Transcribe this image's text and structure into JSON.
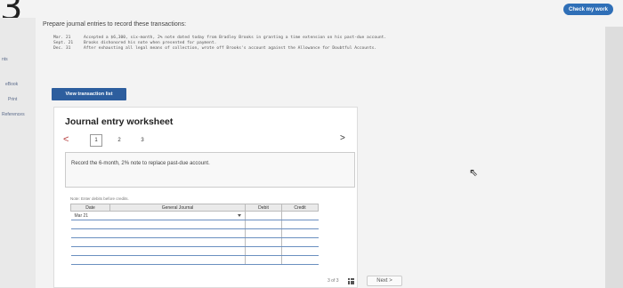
{
  "header": {
    "question_number": "3",
    "check_button": "Check my work"
  },
  "left_rail": [
    "nts",
    "eBook",
    "Print",
    "References"
  ],
  "instructions": "Prepare journal entries to record these transactions:",
  "transactions": [
    {
      "date": "Mar. 21",
      "text": "Accepted a $6,300, six-month, 2% note dated today from Bradley Brooks in granting a time extension on his past-due account."
    },
    {
      "date": "Sept. 21",
      "text": "Brooks dishonored his note when presented for payment."
    },
    {
      "date": "Dec. 31",
      "text": "After exhausting all legal means of collection, wrote off Brooks's account against the Allowance for Doubtful Accounts."
    }
  ],
  "view_button": "View transaction list",
  "worksheet": {
    "title": "Journal entry worksheet",
    "prev": "<",
    "next": ">",
    "steps": [
      "1",
      "2",
      "3"
    ],
    "active_step": 1,
    "task": "Record the 6-month, 2% note to replace past-due account.",
    "note": "Note: Enter debits before credits.",
    "columns": {
      "date": "Date",
      "account": "General Journal",
      "debit": "Debit",
      "credit": "Credit"
    },
    "rows": [
      {
        "date": "Mar 21",
        "account": "",
        "debit": "",
        "credit": ""
      },
      {
        "date": "",
        "account": "",
        "debit": "",
        "credit": ""
      },
      {
        "date": "",
        "account": "",
        "debit": "",
        "credit": ""
      },
      {
        "date": "",
        "account": "",
        "debit": "",
        "credit": ""
      },
      {
        "date": "",
        "account": "",
        "debit": "",
        "credit": ""
      },
      {
        "date": "",
        "account": "",
        "debit": "",
        "credit": ""
      }
    ]
  },
  "footer": {
    "pager": "3 of 3",
    "next_button": "Next >"
  }
}
